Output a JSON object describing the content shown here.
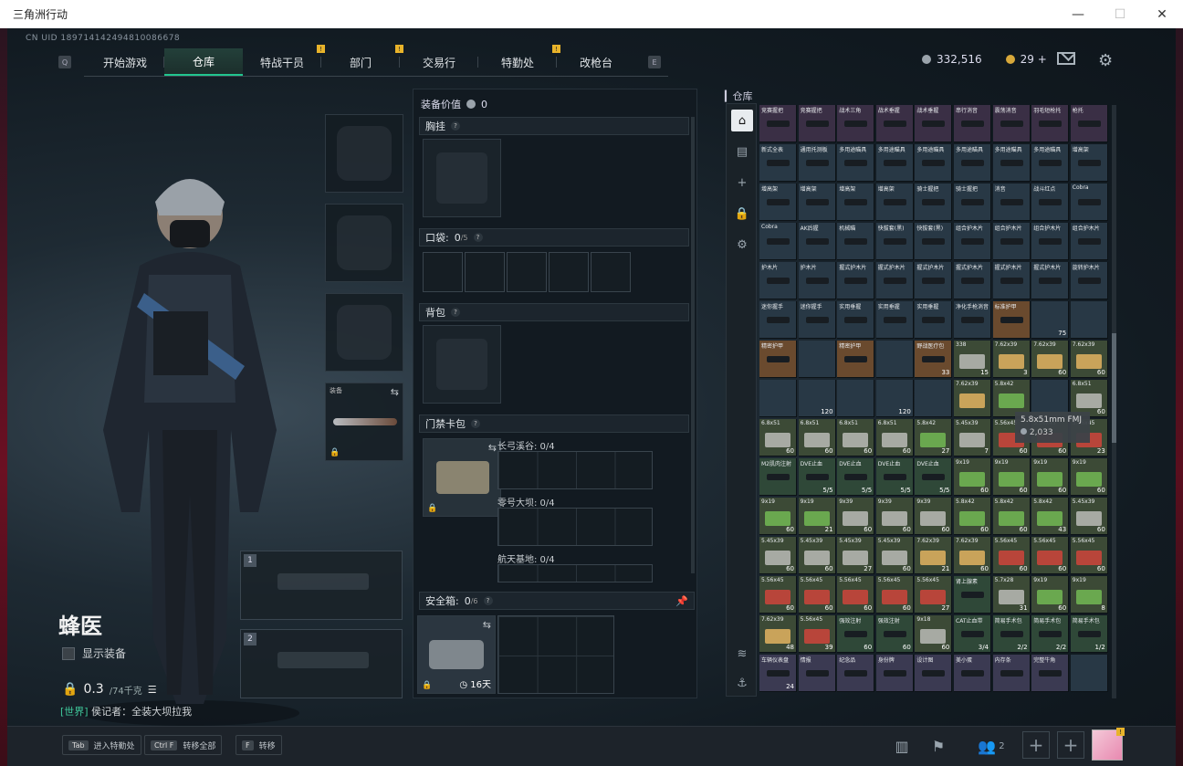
{
  "window": {
    "title": "三角洲行动",
    "minimize": "—",
    "maximize": "☐",
    "close": "✕"
  },
  "uid": "CN UID 189714142494810086678",
  "nav": {
    "left_key": "Q",
    "right_key": "E",
    "tabs": [
      {
        "label": "开始游戏",
        "active": false,
        "badge": ""
      },
      {
        "label": "仓库",
        "active": true,
        "badge": ""
      },
      {
        "label": "特战干员",
        "active": false,
        "badge": "!"
      },
      {
        "label": "部门",
        "active": false,
        "badge": "!"
      },
      {
        "label": "交易行",
        "active": false,
        "badge": ""
      },
      {
        "label": "特勤处",
        "active": false,
        "badge": "!"
      },
      {
        "label": "改枪台",
        "active": false,
        "badge": ""
      }
    ]
  },
  "currency": {
    "coins": "332,516",
    "tokens": "29 +"
  },
  "character": {
    "name": "蜂医",
    "show_equipment": "显示装备",
    "weight": "0.3",
    "weight_max": "/74千克",
    "chat_channel": "[世界]",
    "chat_text": "侯记者：全装大坝拉我"
  },
  "melee_slot": {
    "label": "装备"
  },
  "weapon_slots": [
    "1",
    "2"
  ],
  "loadout": {
    "equip_value_label": "装备价值",
    "equip_value": "0",
    "chest_rig": "胸挂",
    "pockets_label": "口袋:",
    "pockets_count": "0",
    "pockets_max": "/5",
    "backpack": "背包",
    "keycard_label": "门禁卡包",
    "maps": [
      {
        "name": "长弓溪谷: 0/4"
      },
      {
        "name": "零号大坝: 0/4"
      },
      {
        "name": "航天基地: 0/4"
      }
    ],
    "safe_box_label": "安全箱:",
    "safe_box_count": "0",
    "safe_box_max": "/6",
    "safe_box_time": "16天"
  },
  "stash": {
    "label": "仓库",
    "tooltip": {
      "title": "5.8x51mm FMJ",
      "value": "2,033"
    },
    "rows": [
      [
        "竞赛握把",
        "竞赛握把",
        "战术三角",
        "战术垂握",
        "战术垂握",
        "串行消音",
        "震荡消音",
        "羽毛短枪托",
        "枪托"
      ],
      [
        "新式全表",
        "通用托测板",
        "多用途瞄具",
        "多用途瞄具",
        "多用途瞄具",
        "多用途瞄具",
        "多用途瞄具",
        "多用途瞄具",
        "增高架"
      ],
      [
        "增高架",
        "增高架",
        "增高架",
        "增高架",
        "骑士握把",
        "骑士握把",
        "消音",
        "战斗红点",
        "Cobra"
      ],
      [
        "Cobra",
        "AK后握",
        "机械瞄",
        "快拔套(黑)",
        "快拔套(黑)",
        "组合护木片",
        "组合护木片",
        "组合护木片",
        "组合护木片"
      ],
      [
        "护木片",
        "护木片",
        "握式护木片",
        "握式护木片",
        "握式护木片",
        "握式护木片",
        "握式护木片",
        "握式护木片",
        "旋转护木片"
      ],
      [
        "迷你握手",
        "迷你握手",
        "实用垂握",
        "实用垂握",
        "实用垂握",
        "净化手枪消音",
        "标准护甲",
        "",
        ""
      ],
      [
        "精密护甲",
        "",
        "精密护甲",
        "",
        "野战医疗包",
        "338",
        "7.62x39",
        "7.62x39",
        "7.62x39"
      ],
      [
        "",
        "",
        "",
        "",
        "",
        "7.62x39",
        "5.8x42",
        "",
        "6.8x51"
      ],
      [
        "6.8x51",
        "6.8x51",
        "6.8x51",
        "6.8x51",
        "5.8x42",
        "5.45x39",
        "5.56x45",
        "5.56x45",
        "5.56x45"
      ],
      [
        "M2肌肉注射",
        "DVE止血",
        "DVE止血",
        "DVE止血",
        "DVE止血",
        "9x19",
        "9x19",
        "9x19",
        "9x19"
      ],
      [
        "9x19",
        "9x19",
        "9x39",
        "9x39",
        "9x39",
        "5.8x42",
        "5.8x42",
        "5.8x42",
        "5.45x39"
      ],
      [
        "5.45x39",
        "5.45x39",
        "5.45x39",
        "5.45x39",
        "7.62x39",
        "7.62x39",
        "5.56x45",
        "5.56x45",
        "5.56x45"
      ],
      [
        "5.56x45",
        "5.56x45",
        "5.56x45",
        "5.56x45",
        "5.56x45",
        "肾上腺素",
        "5.7x28",
        "9x19",
        "9x19"
      ],
      [
        "7.62x39",
        "5.56x45",
        "强效注射",
        "强效注射",
        "9x18",
        "CAT止血带",
        "简易手术包",
        "简易手术包",
        "简易手术包"
      ],
      [
        "车辆仪表盘",
        "情报",
        "纪念品",
        "身份牌",
        "设计图",
        "美小蛋",
        "内存条",
        "完整牛角",
        ""
      ]
    ],
    "qty": [
      [
        "",
        "",
        "",
        "",
        "",
        "",
        "",
        "",
        ""
      ],
      [
        "",
        "",
        "",
        "",
        "",
        "",
        "",
        "",
        ""
      ],
      [
        "",
        "",
        "",
        "",
        "",
        "",
        "",
        "",
        ""
      ],
      [
        "",
        "",
        "",
        "",
        "",
        "",
        "",
        "",
        ""
      ],
      [
        "",
        "",
        "",
        "",
        "",
        "",
        "",
        "",
        ""
      ],
      [
        "",
        "",
        "",
        "",
        "",
        "",
        "",
        "75",
        ""
      ],
      [
        "",
        "",
        "",
        "",
        "33",
        "15",
        "3",
        "60",
        "60"
      ],
      [
        "",
        "120",
        "",
        "120",
        "",
        "",
        "",
        "",
        "60"
      ],
      [
        "60",
        "60",
        "60",
        "60",
        "27",
        "7",
        "60",
        "60",
        "23"
      ],
      [
        "",
        "5/5",
        "5/5",
        "5/5",
        "5/5",
        "60",
        "60",
        "60",
        "60"
      ],
      [
        "60",
        "21",
        "60",
        "60",
        "60",
        "60",
        "60",
        "43",
        "60"
      ],
      [
        "60",
        "60",
        "27",
        "60",
        "21",
        "60",
        "60",
        "60",
        "60"
      ],
      [
        "60",
        "60",
        "60",
        "60",
        "27",
        "",
        "31",
        "60",
        "8"
      ],
      [
        "48",
        "39",
        "60",
        "60",
        "60",
        "3/4",
        "2/2",
        "2/2",
        "1/2"
      ],
      [
        "24",
        "",
        "",
        "",
        "",
        "",
        "",
        "",
        ""
      ]
    ]
  },
  "bottom": {
    "keys": [
      {
        "k": "Tab",
        "label": "进入特勤处"
      },
      {
        "k": "Ctrl F",
        "label": "转移全部"
      },
      {
        "k": "F",
        "label": "转移"
      }
    ],
    "friends": "2",
    "avatar_badge": "!"
  }
}
